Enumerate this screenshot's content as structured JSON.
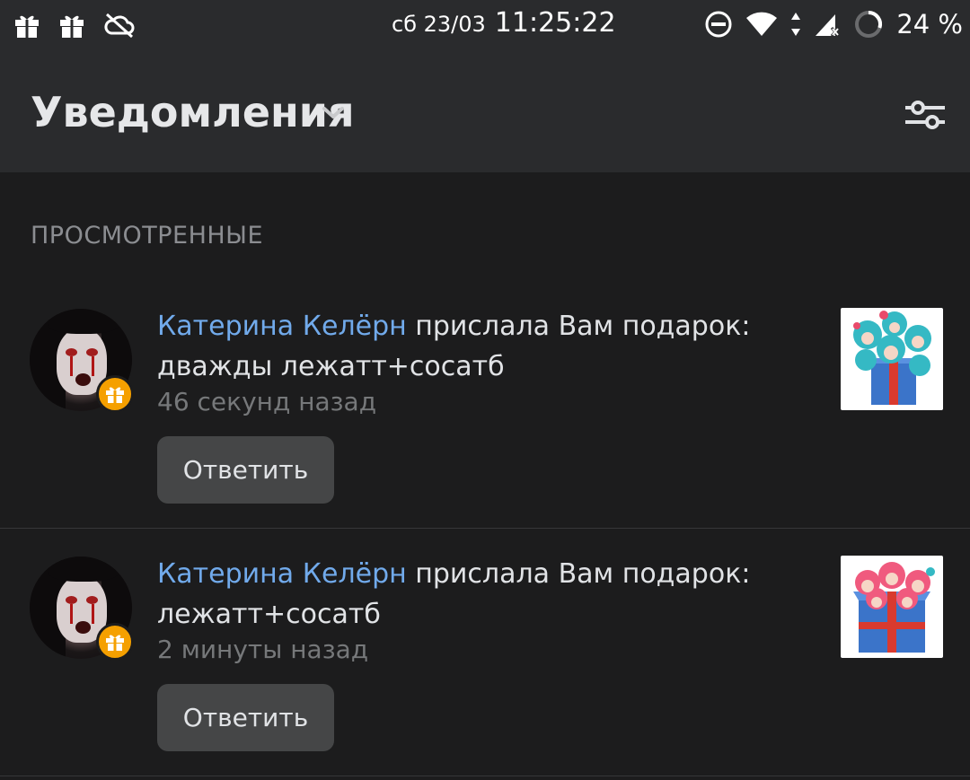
{
  "status_bar": {
    "date": "сб 23/03",
    "time": "11:25:22",
    "battery": "24 %",
    "icons": [
      "gift-icon",
      "gift-icon",
      "cloud-off-icon",
      "do-not-disturb-icon",
      "wifi-icon",
      "data-arrows-icon",
      "signal-icon",
      "battery-ring-icon"
    ]
  },
  "header": {
    "title": "Уведомления",
    "chevron": "chevron-down-icon",
    "filter": "filter-sliders-icon"
  },
  "section": {
    "title": "ПРОСМОТРЕННЫЕ"
  },
  "notifications": [
    {
      "name": "Катерина Келёрн",
      "action": " прислала Вам подарок:",
      "gift_text": "дважды лежатт+сосатб",
      "time": "46 секунд назад",
      "reply_label": "Ответить",
      "gift_color": "#35b9c4"
    },
    {
      "name": "Катерина Келёрн",
      "action": " прислала Вам подарок:",
      "gift_text": "лежатт+сосатб",
      "time": "2 минуты назад",
      "reply_label": "Ответить",
      "gift_color": "#f05a7e"
    }
  ],
  "colors": {
    "background": "#1c1c1d",
    "header": "#2a2b2d",
    "accent_link": "#71aaeb",
    "badge": "#f5a000",
    "button": "#454647"
  }
}
